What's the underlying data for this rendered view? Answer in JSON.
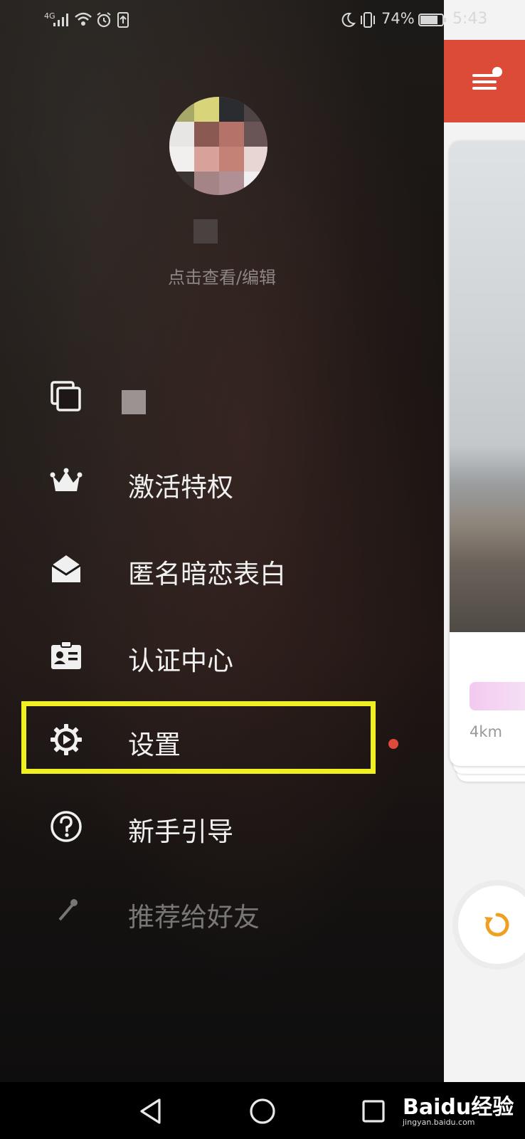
{
  "status_bar": {
    "network": "4G",
    "battery": "74%",
    "time": "5:43"
  },
  "profile": {
    "hint": "点击查看/编辑"
  },
  "menu": {
    "items": [
      {
        "id": "photos",
        "label": "",
        "icon": "photos-icon"
      },
      {
        "id": "privilege",
        "label": "激活特权",
        "icon": "crown-icon"
      },
      {
        "id": "anonymous",
        "label": "匿名暗恋表白",
        "icon": "envelope-icon"
      },
      {
        "id": "verify",
        "label": "认证中心",
        "icon": "id-card-icon"
      },
      {
        "id": "settings",
        "label": "设置",
        "icon": "gear-icon"
      },
      {
        "id": "guide",
        "label": "新手引导",
        "icon": "help-icon"
      },
      {
        "id": "recommend",
        "label": "推荐给好友",
        "icon": "share-icon"
      }
    ]
  },
  "peek": {
    "distance": "4km"
  },
  "watermark": {
    "brand": "Baidu经验",
    "site": "jingyan.baidu.com"
  },
  "colors": {
    "accent": "#dc4a38",
    "highlight": "#f0f021",
    "refresh": "#f0a020"
  }
}
